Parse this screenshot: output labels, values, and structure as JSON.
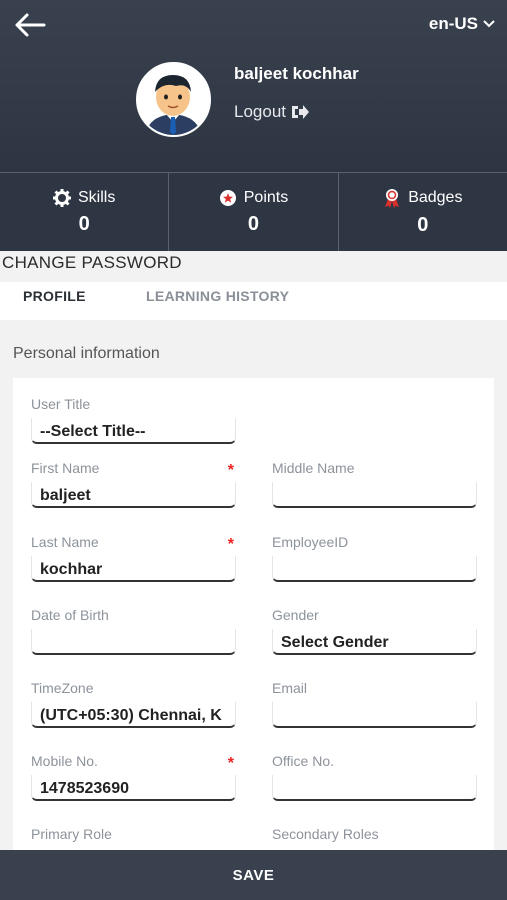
{
  "header": {
    "language": "en-US",
    "user_name": "baljeet kochhar",
    "logout_label": "Logout"
  },
  "stats": [
    {
      "label": "Skills",
      "value": "0",
      "icon": "gear-icon"
    },
    {
      "label": "Points",
      "value": "0",
      "icon": "star-badge-icon"
    },
    {
      "label": "Badges",
      "value": "0",
      "icon": "ribbon-icon"
    }
  ],
  "change_password_label": "CHANGE PASSWORD",
  "tabs": [
    {
      "label": "PROFILE",
      "active": true
    },
    {
      "label": "LEARNING HISTORY",
      "active": false
    }
  ],
  "section_title": "Personal information",
  "fields": {
    "user_title": {
      "label": "User Title",
      "value": "--Select Title--"
    },
    "first_name": {
      "label": "First Name",
      "value": "baljeet",
      "required": "*"
    },
    "middle_name": {
      "label": "Middle Name",
      "value": ""
    },
    "last_name": {
      "label": "Last Name",
      "value": "kochhar",
      "required": "*"
    },
    "employee_id": {
      "label": "EmployeeID",
      "value": ""
    },
    "date_of_birth": {
      "label": "Date of Birth",
      "value": ""
    },
    "gender": {
      "label": "Gender",
      "value": "Select Gender"
    },
    "timezone": {
      "label": "TimeZone",
      "value": "(UTC+05:30) Chennai, K"
    },
    "email": {
      "label": "Email",
      "value": ""
    },
    "mobile_no": {
      "label": "Mobile No.",
      "value": "1478523690",
      "required": "*"
    },
    "office_no": {
      "label": "Office No.",
      "value": ""
    },
    "primary_role": {
      "label": "Primary Role"
    },
    "secondary_roles": {
      "label": "Secondary Roles"
    }
  },
  "save_label": "SAVE",
  "colors": {
    "header_bg": "#39414f",
    "required": "#ee2222"
  }
}
